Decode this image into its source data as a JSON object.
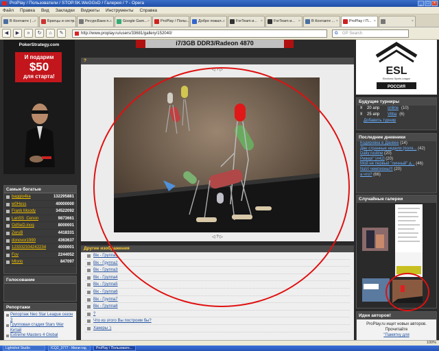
{
  "window": {
    "title": "ProPlay / Пользователи / STOP.SK.WeGGxD / Галерея / ? - Opera"
  },
  "menu": [
    "Файл",
    "Правка",
    "Вид",
    "Закладки",
    "Виджеты",
    "Инструменты",
    "Справка"
  ],
  "tabs": [
    {
      "label": "В Контакте | ...",
      "color": "#4a6fa0"
    },
    {
      "label": "Братцы и сестр...",
      "color": "#c33"
    },
    {
      "label": "РесурсБанк п...",
      "color": "#777"
    },
    {
      "label": "Google Gam...",
      "color": "#3a7"
    },
    {
      "label": "ProPlay / Поль...",
      "color": "#c22"
    },
    {
      "label": "Добро пожал...",
      "color": "#36c"
    },
    {
      "label": "ForTeam и...",
      "color": "#333"
    },
    {
      "label": "ForTeam и...",
      "color": "#333"
    },
    {
      "label": "В Контакте ...",
      "color": "#4a6fa0"
    },
    {
      "label": "ProPlay / П...",
      "color": "#c22",
      "active": true
    },
    {
      "label": "",
      "color": "#777"
    }
  ],
  "nav": {
    "url": "http://www.proplay.ru/users/33681/gallery/152040/",
    "search_placeholder": "GP Search"
  },
  "ad": {
    "brand": "PokerStrategy.com",
    "line1": "И подарим",
    "line2": "$50",
    "line3": "для старта!"
  },
  "banner": "i7/3GB DDR3/Radeon 4870",
  "left": {
    "rich_title": "Самые богатые",
    "rich": [
      {
        "name": "baggio4ka",
        "value": "132295881"
      },
      {
        "name": "w0Hess",
        "value": "40000000"
      },
      {
        "name": "Frank Moody",
        "value": "34522092"
      },
      {
        "name": "LanSS_Cenon",
        "value": "9873661"
      },
      {
        "name": "OdSeD.inoq",
        "value": "8000001"
      },
      {
        "name": "ZeruB",
        "value": "4418331"
      },
      {
        "name": "donovor1990",
        "value": "4363637"
      },
      {
        "name": "123332334242234",
        "value": "4000001"
      },
      {
        "name": "Fov",
        "value": "2244052"
      },
      {
        "name": "Mlorio",
        "value": "847097"
      }
    ],
    "vote_title": "Голосование",
    "reports_title": "Репортажи",
    "reports": [
      "Репортаж Neo Star League сезон 3",
      "Групповая стадия Stars War Китай",
      "Extreme Masters 4 Global"
    ]
  },
  "gallery": {
    "header": "?",
    "pager_top": "◁ ? ▷",
    "pager_bottom": "◁ ? ▷",
    "others_header": "Другие изображения",
    "others": [
      "Вік - Группа1",
      "Вік - Группа2",
      "Вік - Группа3",
      "Вік - Группа4",
      "Вік - Группа5",
      "Вік - Группа6",
      "Вік - Группа7",
      "Вік - Группа8",
      "?",
      "Что из этого Вы построим бы?",
      "Хакеры :)"
    ]
  },
  "right": {
    "esl_label": "ESL",
    "esl_sub": "Electronic Sports League",
    "esl_region": "РОССИЯ",
    "tourn_title": "Будущие турниры",
    "tournaments": [
      {
        "date": "20 апр",
        "title": "online",
        "count": "(10)"
      },
      {
        "date": "25 апр",
        "title": "Vilba",
        "count": "(6)"
      }
    ],
    "add_tournament": "Добавить турнир",
    "diaries_title": "Последние дневники",
    "diaries": [
      {
        "title": "Кодировка в Данвее",
        "count": "(14)"
      },
      {
        "title": "Две странные недели (поля...",
        "count": "(42)"
      },
      {
        "title": "Daily routine",
        "count": "(20)"
      },
      {
        "title": "Ривері\" [#42]",
        "count": "(20)"
      },
      {
        "title": "Мой не первый \"личный\" д...",
        "count": "(46)"
      },
      {
        "title": "NaVi чемпионы!!!",
        "count": "(20)"
      },
      {
        "title": "а что?",
        "count": "(66)"
      }
    ],
    "rgal_title": "Случайные галереи",
    "idea_title": "Идеи авторов!",
    "idea_text": "ProPlay.ru ищет новых авторов. Прочитайте",
    "idea_link": "\"Памятку для"
  },
  "status": {
    "zoom": "100%"
  },
  "taskbar": [
    "Lightshot Studio",
    "ICQ2_3777 - Мини-гид",
    "ProPlay / Пользовате..."
  ],
  "colors": {
    "accent": "#ffcc33",
    "link": "#2050a0",
    "annotation": "#e01010"
  }
}
